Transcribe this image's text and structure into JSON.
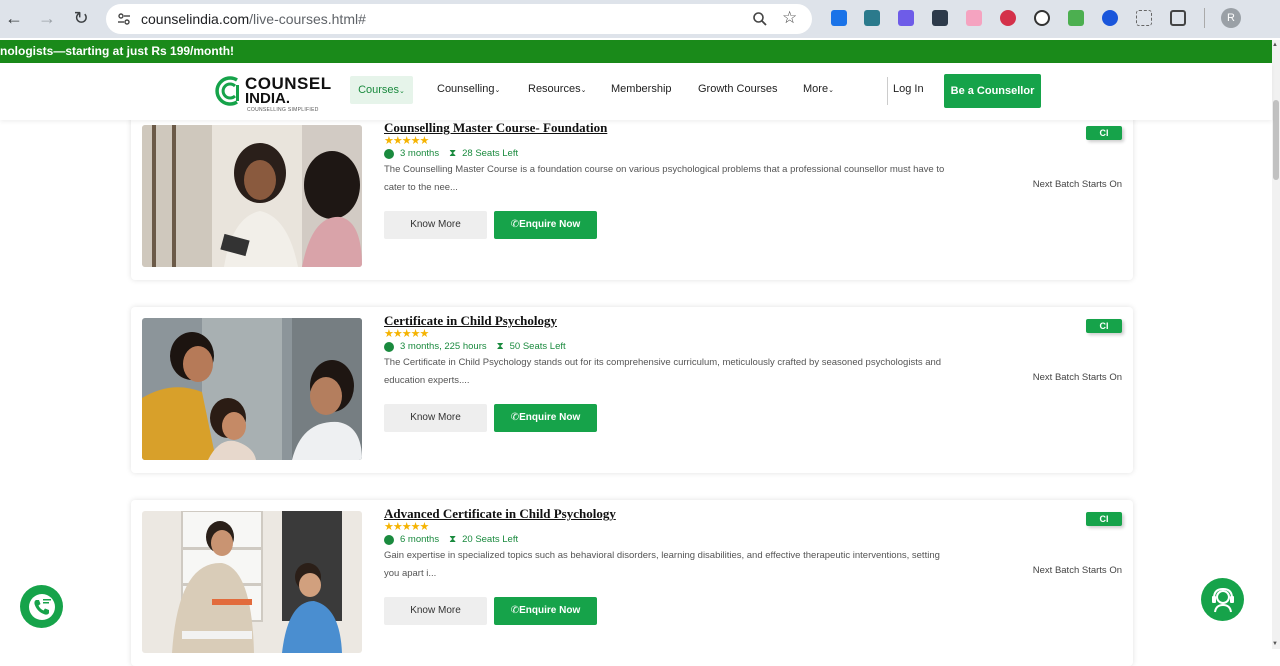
{
  "browser": {
    "url_domain": "counselindia.com",
    "url_path": "/live-courses.html#",
    "profile_initial": "R"
  },
  "promo": {
    "text": "nologists—starting at just Rs 199/month!"
  },
  "header": {
    "logo_line1": "COUNSEL",
    "logo_line2": "INDIA.",
    "logo_tagline": "COUNSELLING SIMPLIFIED",
    "nav": {
      "courses": "Courses",
      "counselling": "Counselling",
      "resources": "Resources",
      "membership": "Membership",
      "growth": "Growth Courses",
      "more": "More"
    },
    "login": "Log In",
    "cta": "Be a Counsellor"
  },
  "courses": [
    {
      "title": "Counselling Master Course- Foundation",
      "rating": "★★★★★",
      "duration": "3 months",
      "seats": "28 Seats Left",
      "description": "The Counselling Master Course is a foundation course on various psychological problems that a professional counsellor must have to cater to the nee...",
      "know_more": "Know More",
      "enquire": "Enquire Now",
      "badge": "CI",
      "next_batch": "Next Batch Starts On"
    },
    {
      "title": "Certificate in Child Psychology",
      "rating": "★★★★★",
      "duration": "3 months, 225 hours",
      "seats": "50 Seats Left",
      "description": "The Certificate in Child Psychology stands out for its comprehensive curriculum, meticulously crafted by seasoned psychologists and education experts....",
      "know_more": "Know More",
      "enquire": "Enquire Now",
      "badge": "CI",
      "next_batch": "Next Batch Starts On"
    },
    {
      "title": "Advanced Certificate in Child Psychology",
      "rating": "★★★★★",
      "duration": "6 months",
      "seats": "20 Seats Left",
      "description": "Gain expertise in specialized topics such as behavioral disorders, learning disabilities, and effective therapeutic interventions, setting you apart i...",
      "know_more": "Know More",
      "enquire": "Enquire Now",
      "badge": "CI",
      "next_batch": "Next Batch Starts On"
    }
  ],
  "colors": {
    "brand_green": "#16a34a",
    "banner_green": "#1a8a1a",
    "star_gold": "#f5b301"
  }
}
